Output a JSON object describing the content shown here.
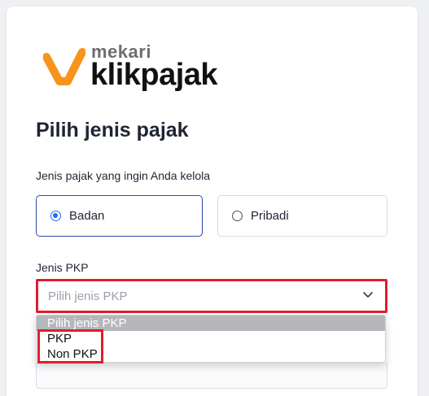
{
  "brand": {
    "small": "mekari",
    "name": "klikpajak",
    "mark_color": "#f7941d"
  },
  "page": {
    "title": "Pilih jenis pajak"
  },
  "tax_type": {
    "label": "Jenis pajak yang ingin Anda kelola",
    "options": [
      {
        "label": "Badan",
        "selected": true
      },
      {
        "label": "Pribadi",
        "selected": false
      }
    ]
  },
  "pkp": {
    "label": "Jenis PKP",
    "placeholder": "Pilih jenis PKP",
    "dropdown_options": [
      "Pilih jenis PKP",
      "PKP",
      "Non PKP"
    ]
  },
  "colors": {
    "accent": "#1e6ee8",
    "selected_border": "#2f4aa8",
    "highlight": "#e01e2e"
  }
}
